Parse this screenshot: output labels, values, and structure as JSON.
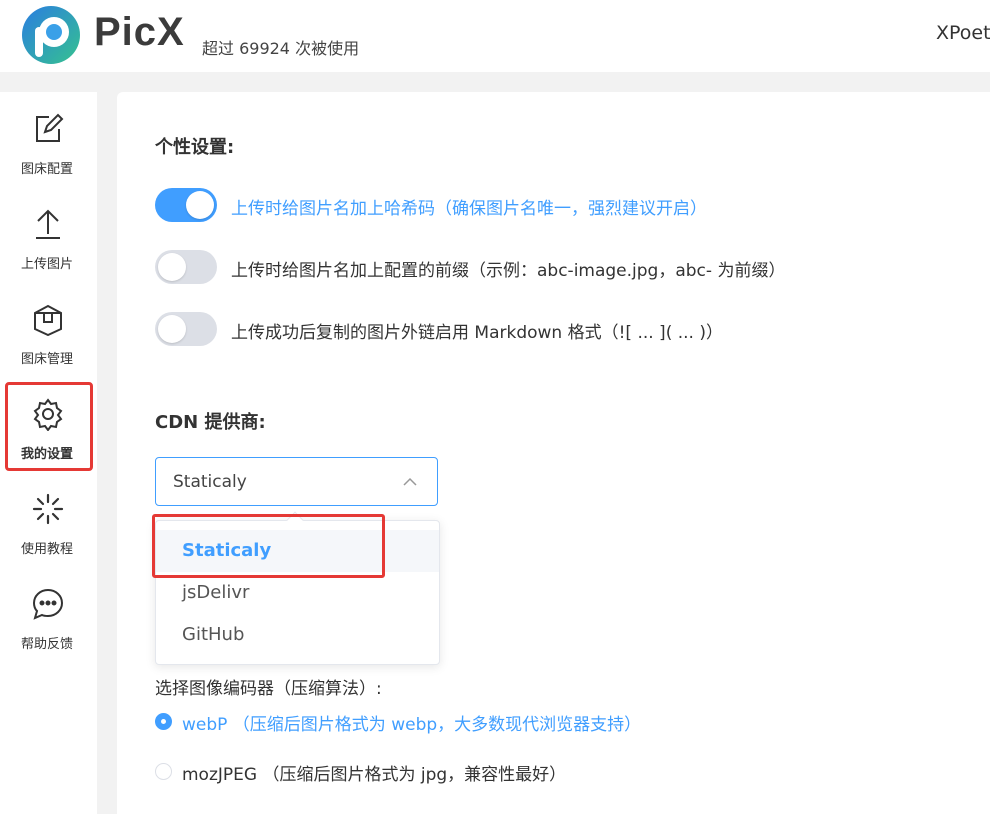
{
  "header": {
    "brand": "PicX",
    "usage": "超过 69924 次被使用",
    "user": "XPoet"
  },
  "sidebar": {
    "items": [
      {
        "label": "图床配置",
        "icon": "edit-icon",
        "active": false
      },
      {
        "label": "上传图片",
        "icon": "upload-icon",
        "active": false
      },
      {
        "label": "图床管理",
        "icon": "box-icon",
        "active": false
      },
      {
        "label": "我的设置",
        "icon": "gear-icon",
        "active": true
      },
      {
        "label": "使用教程",
        "icon": "loading-icon",
        "active": false
      },
      {
        "label": "帮助反馈",
        "icon": "chat-icon",
        "active": false
      }
    ]
  },
  "settings": {
    "personal_title": "个性设置:",
    "toggles": [
      {
        "label": "上传时给图片名加上哈希码（确保图片名唯一，强烈建议开启）",
        "on": true
      },
      {
        "label": "上传时给图片名加上配置的前缀（示例：abc-image.jpg，abc- 为前缀）",
        "on": false
      },
      {
        "label": "上传成功后复制的图片外链启用 Markdown 格式（![ ... ]( ... )）",
        "on": false
      }
    ],
    "cdn_title": "CDN 提供商:",
    "cdn_selected": "Staticaly",
    "cdn_options": [
      "Staticaly",
      "jsDelivr",
      "GitHub"
    ],
    "encoder_title": "选择图像编码器（压缩算法）:",
    "encoders": [
      {
        "label": "webP （压缩后图片格式为 webp，大多数现代浏览器支持）",
        "checked": true
      },
      {
        "label": "mozJPEG （压缩后图片格式为 jpg，兼容性最好）",
        "checked": false
      }
    ]
  },
  "colors": {
    "accent": "#409eff",
    "highlight": "#e53935"
  }
}
